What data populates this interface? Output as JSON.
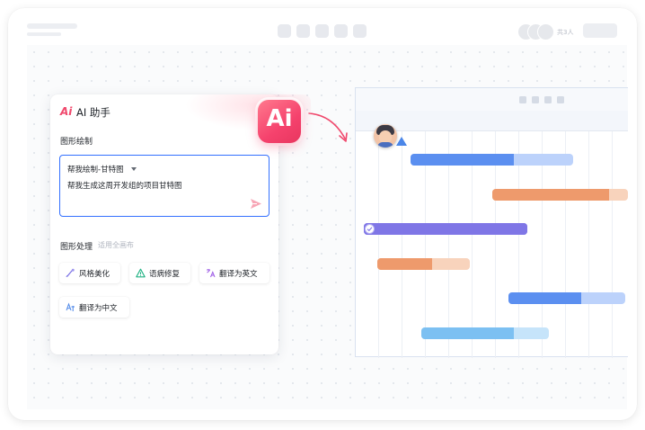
{
  "topbar": {
    "member_count": "共3人"
  },
  "ai_badge": {
    "label": "Ai"
  },
  "panel": {
    "logo": "Ai",
    "title": "AI 助手",
    "section_draw": "图形绘制",
    "select_label": "帮我绘制-甘特图",
    "input_text": "帮我生成这周开发组的项目甘特图",
    "section_process": "图形处理",
    "section_hint": "适用全画布",
    "actions": [
      {
        "label": "风格美化",
        "icon": "brush-icon"
      },
      {
        "label": "语病修复",
        "icon": "warning-triangle-icon"
      },
      {
        "label": "翻译为英文",
        "icon": "translate-icon"
      },
      {
        "label": "翻译为中文",
        "icon": "translate-zh-icon"
      }
    ]
  },
  "gantt": {
    "tasks": [
      {
        "start": 0.2,
        "progress_end": 0.58,
        "end": 0.8,
        "color": "#5b8ff0",
        "light": "#bcd2fb"
      },
      {
        "start": 0.5,
        "progress_end": 0.93,
        "end": 1.0,
        "color": "#ee9a6c",
        "light": "#f8d3bc"
      },
      {
        "start": 0.03,
        "progress_end": 0.63,
        "end": 0.63,
        "color": "#7f76e6",
        "light": "#7f76e6",
        "done": true
      },
      {
        "start": 0.08,
        "progress_end": 0.28,
        "end": 0.42,
        "color": "#ee9a6c",
        "light": "#f8d3bc"
      },
      {
        "start": 0.56,
        "progress_end": 0.83,
        "end": 0.99,
        "color": "#5b8ff0",
        "light": "#bcd2fb"
      },
      {
        "start": 0.24,
        "progress_end": 0.58,
        "end": 0.71,
        "color": "#7cc0f2",
        "light": "#c6e4fa"
      }
    ]
  }
}
